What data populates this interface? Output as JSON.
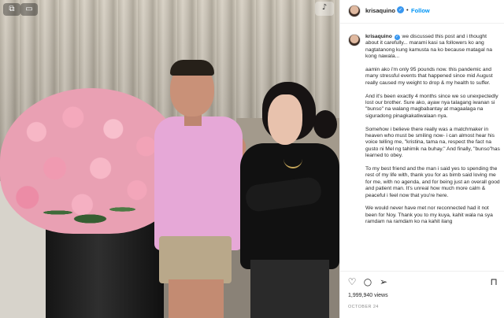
{
  "media": {
    "controls": {
      "first_icon": "pip-icon",
      "second_icon": "screen-icon",
      "third_icon": "sound-icon"
    }
  },
  "header": {
    "username": "krisaquino",
    "separator": "•",
    "follow_label": "Follow",
    "verified_mark": "✓"
  },
  "caption": {
    "username": "krisaquino",
    "paragraphs": [
      "we discussed this post and i thought about it carefully... marami kasi sa followers ko ang nagtatanong kung kamusta na ko because matagal na kong nawala...",
      "aamin ako i'm only 95 pounds now. this pandemic and many stressful events that happened since mid August really caused my weight to drop & my health to suffer.",
      "And it's been exactly 4 months since we so unexpectedly lost our brother. Sure ako, ayaw nya talagang iwanan si \"bunso\" na walang magbabantay at magaalaga na siguradong pinagkakatiwalaan nya.",
      "Somehow i believe there really was a matchmaker in heaven who must be smiling now- i can almost hear his voice telling me, \"kristina, tama na, respect the fact na gusto ni Mel ng tahimik na buhay.\" And finally, \"bunso\"has learned to obey.",
      "To my best friend and the man i said yes to spending the rest of my life with, thank you for as bimb said loving me for me, with no agenda, and for being just an overall good and patient man. It's unreal how much more calm & peaceful i feel now that you're here.",
      "We would never have met nor reconnected had it not been for Noy. Thank you to my kuya, kahit wala na sya ramdam na ramdam ko na kahit ilang"
    ]
  },
  "actions": {
    "heart_icon": "heart-icon",
    "comment_icon": "comment-icon",
    "share_icon": "share-icon",
    "save_icon": "bookmark-icon",
    "views": "1,999,940 views",
    "date": "OCTOBER 24"
  }
}
